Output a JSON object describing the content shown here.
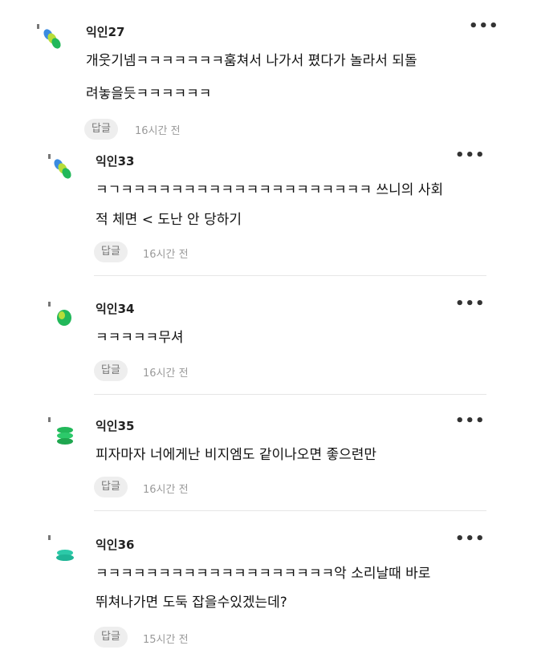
{
  "comments": [
    {
      "author": "익인27",
      "lines": [
        "개웃기넴ㅋㅋㅋㅋㅋㅋㅋ훔쳐서 나가서 폈다가 놀라서 되돌",
        "려놓을듯ㅋㅋㅋㅋㅋㅋ"
      ],
      "reply_label": "답글",
      "time": "16시간 전",
      "more_label": "•••",
      "avatar_icon": "leaf-avatar-icon"
    },
    {
      "author": "익인33",
      "lines": [
        "ㅋㄱㅋㅋㅋㅋㅋㅋㅋㅋㅋㅋㅋㅋㅋㅋㅋㅋㅋㅋㅋㅋ 쓰니의 사회",
        "적 체면 < 도난 안 당하기"
      ],
      "reply_label": "답글",
      "time": "16시간 전",
      "more_label": "•••",
      "avatar_icon": "leaf-avatar-icon"
    },
    {
      "author": "익인34",
      "lines": [
        "ㅋㅋㅋㅋㅋ무셔"
      ],
      "reply_label": "답글",
      "time": "16시간 전",
      "more_label": "•••",
      "avatar_icon": "green-blob-avatar-icon"
    },
    {
      "author": "익인35",
      "lines": [
        "피자마자 너에게난 비지엠도 같이나오면 좋으련만"
      ],
      "reply_label": "답글",
      "time": "16시간 전",
      "more_label": "•••",
      "avatar_icon": "green-stack-avatar-icon"
    },
    {
      "author": "익인36",
      "lines": [
        "ㅋㅋㅋㅋㅋㅋㅋㅋㅋㅋㅋㅋㅋㅋㅋㅋㅋㅋㅋ악 소리날때 바로",
        "뛰쳐나가면 도둑 잡을수있겠는데?"
      ],
      "reply_label": "답글",
      "time": "15시간 전",
      "more_label": "•••",
      "avatar_icon": "teal-stack-avatar-icon"
    }
  ],
  "colors": {
    "accent_green": "#22b85a",
    "accent_teal": "#2cc9a8",
    "accent_blue": "#3a8be0",
    "accent_lime": "#b7dd3a",
    "reply_bg": "#eeeeee",
    "time_text": "#9a9a9a"
  }
}
